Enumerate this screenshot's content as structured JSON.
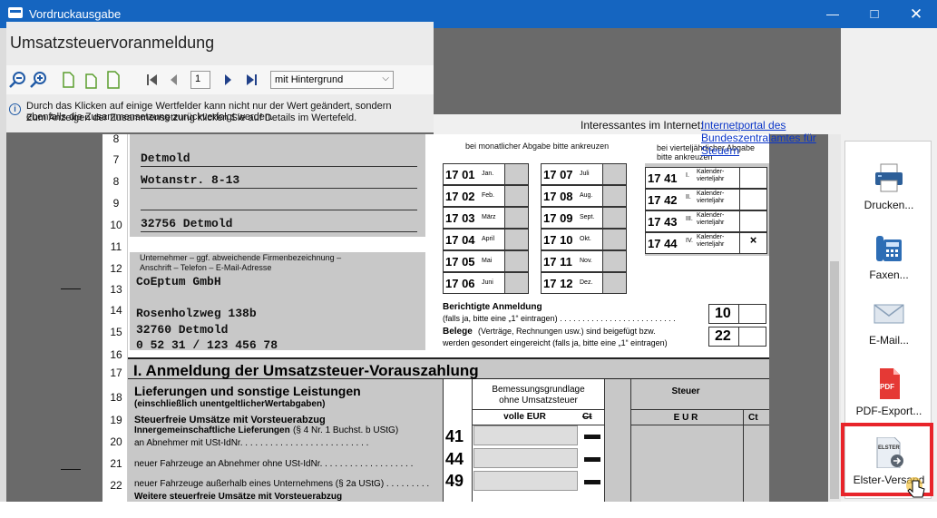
{
  "window": {
    "title": "Vordruckausgabe"
  },
  "header": {
    "form_title": "Umsatzsteuervoranmeldung",
    "page_number": "1",
    "background_option": "mit Hintergrund",
    "info_line1": "Durch das Klicken auf einige Wertfelder kann nicht nur der Wert geändert, sondern ebenfalls die Zusammensetzung zurückverfolgt werden.",
    "info_line2": "Zum Anzeigen der Zusammensetzung klicken Sie auf Details im Wertefeld."
  },
  "internet": {
    "label": "Interessantes im Internet:",
    "link": "Internetportal des Bundeszentralamtes für Steuern"
  },
  "side": {
    "print": "Drucken...",
    "fax": "Faxen...",
    "email": "E-Mail...",
    "pdf": "PDF-Export...",
    "elster": "Elster-Versand",
    "pdf_badge": "PDF",
    "elster_badge": "ELSTER"
  },
  "form": {
    "lines": [
      "8",
      "7",
      "8",
      "9",
      "10",
      "11",
      "12",
      "13",
      "14",
      "15",
      "16",
      "17",
      "18",
      "19",
      "20",
      "21",
      "22"
    ],
    "city": "Detmold",
    "street": "Wotanstr. 8-13",
    "zip_city": "32756  Detmold",
    "company_label1": "Unternehmer – ggf. abweichende Firmenbezeichnung –",
    "company_label2": "Anschrift – Telefon – E-Mail-Adresse",
    "company": "CoEptum GmbH",
    "company_street": "Rosenholzweg 138b",
    "company_zip": "32760    Detmold",
    "company_phone": "0 52 31 / 123 456 78",
    "monthly_note": "bei monatlicher Abgabe bitte ankreuzen",
    "quarter_note1": "bei vierteljährlicher Abgabe",
    "quarter_note2": "bitte ankreuzen",
    "months": [
      {
        "c": "17 01",
        "m": "Jan."
      },
      {
        "c": "17 02",
        "m": "Feb."
      },
      {
        "c": "17 03",
        "m": "März"
      },
      {
        "c": "17 04",
        "m": "April"
      },
      {
        "c": "17 05",
        "m": "Mai"
      },
      {
        "c": "17 06",
        "m": "Juni"
      },
      {
        "c": "17 07",
        "m": "Juli"
      },
      {
        "c": "17 08",
        "m": "Aug."
      },
      {
        "c": "17 09",
        "m": "Sept."
      },
      {
        "c": "17 10",
        "m": "Okt."
      },
      {
        "c": "17 11",
        "m": "Nov."
      },
      {
        "c": "17 12",
        "m": "Dez."
      }
    ],
    "quarters": [
      {
        "c": "17 41",
        "q": "I.",
        "l1": "Kalender-",
        "l2": "vierteljahr"
      },
      {
        "c": "17 42",
        "q": "II.",
        "l1": "Kalender-",
        "l2": "vierteljahr"
      },
      {
        "c": "17 43",
        "q": "III.",
        "l1": "Kalender-",
        "l2": "vierteljahr"
      },
      {
        "c": "17 44",
        "q": "IV.",
        "l1": "Kalender-",
        "l2": "vierteljahr",
        "x": "×"
      }
    ],
    "corrected_title": "Berichtigte Anmeldung",
    "corrected_note": "(falls ja, bitte eine „1“ eintragen) . . . . . . . . . . . . . . . . . . . . . . . . . .",
    "corrected_code": "10",
    "receipts_title": "Belege",
    "receipts_note": "(Verträge, Rechnungen usw.) sind beigefügt bzw.",
    "receipts_note2": "werden gesondert eingereicht (falls ja, bitte eine „1“ eintragen)",
    "receipts_code": "22",
    "section_title": "I. Anmeldung der Umsatzsteuer-Vorauszahlung",
    "deliveries_title": "Lieferungen und sonstige Leistungen",
    "deliveries_sub": "(einschließlich unentgeltlicherWertabgaben)",
    "col_basis": "Bemessungsgrundlage",
    "col_basis2": "ohne Umsatzsteuer",
    "col_tax": "Steuer",
    "col_eur": "volle EUR",
    "col_ct": "Ct",
    "col_eur2": "E U R",
    "col_ct2": "Ct",
    "taxfree_title": "Steuerfreie Umsätze mit Vorsteuerabzug",
    "intra_title": "Innergemeinschaftliche Lieferungen",
    "intra_ref": "(§ 4 Nr. 1 Buchst. b UStG)",
    "row41": "an Abnehmer mit USt-IdNr. . . . . . . . . . . . . . . . . . . . . . . . . .",
    "code41": "41",
    "row44": "neuer Fahrzeuge an Abnehmer ohne USt-IdNr. . . . . . . . . . . . . . . . . . .",
    "code44": "44",
    "row49": "neuer Fahrzeuge außerhalb eines Unternehmens (§ 2a UStG) . . . . . . . . .",
    "code49": "49",
    "further_title": "Weitere steuerfreie Umsätze mit Vorsteuerabzug"
  }
}
